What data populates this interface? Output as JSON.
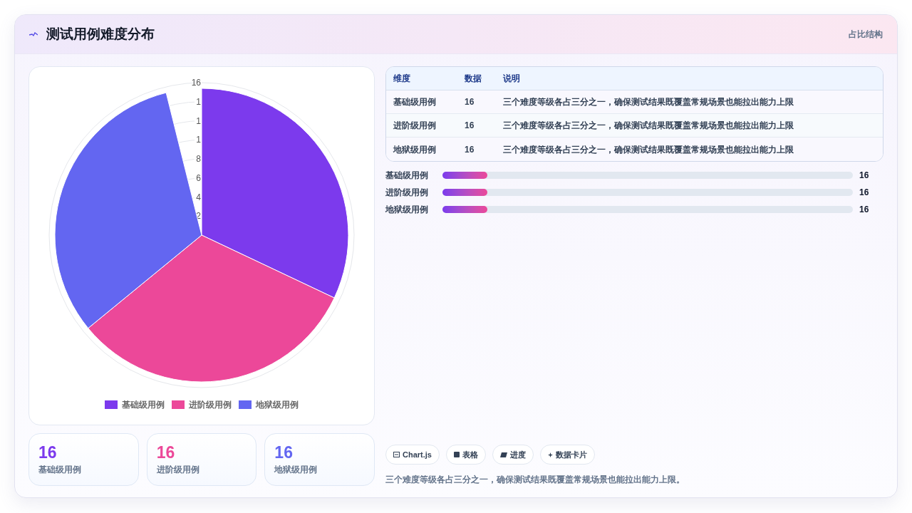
{
  "header": {
    "title": "测试用例难度分布",
    "tag": "占比结构"
  },
  "chart": {
    "chart_data": {
      "type": "pie",
      "categories": [
        "基础级用例",
        "进阶级用例",
        "地狱级用例"
      ],
      "values": [
        33.33,
        33.33,
        33.34
      ],
      "colors": [
        "#7c3aed",
        "#ec4899",
        "#6366f1"
      ]
    },
    "scale_labels": [
      "16",
      "1",
      "1",
      "1",
      "8",
      "6",
      "4",
      "2"
    ]
  },
  "stats": [
    {
      "value": "16",
      "label": "基础级用例",
      "color": "#7c3aed"
    },
    {
      "value": "16",
      "label": "进阶级用例",
      "color": "#ec4899"
    },
    {
      "value": "16",
      "label": "地狱级用例",
      "color": "#6366f1"
    }
  ],
  "table": {
    "columns": [
      "维度",
      "数据",
      "说明"
    ],
    "rows": [
      [
        "基础级用例",
        "16",
        "三个难度等级各占三分之一，确保测试结果既覆盖常规场景也能拉出能力上限"
      ],
      [
        "进阶级用例",
        "16",
        "三个难度等级各占三分之一，确保测试结果既覆盖常规场景也能拉出能力上限"
      ],
      [
        "地狱级用例",
        "16",
        "三个难度等级各占三分之一，确保测试结果既覆盖常规场景也能拉出能力上限"
      ]
    ]
  },
  "bars": [
    {
      "label": "基础级用例",
      "level": 0.11,
      "reading": "16"
    },
    {
      "label": "进阶级用例",
      "level": 0.11,
      "reading": "16"
    },
    {
      "label": "地狱级用例",
      "level": 0.11,
      "reading": "16"
    }
  ],
  "chips": [
    {
      "kind": "chart",
      "label": "Chart.js"
    },
    {
      "kind": "table",
      "label": "表格"
    },
    {
      "kind": "progress",
      "label": "进度"
    },
    {
      "kind": "card",
      "label": "数据卡片"
    }
  ],
  "note": "三个难度等级各占三分之一，确保测试结果既覆盖常规场景也能拉出能力上限。"
}
